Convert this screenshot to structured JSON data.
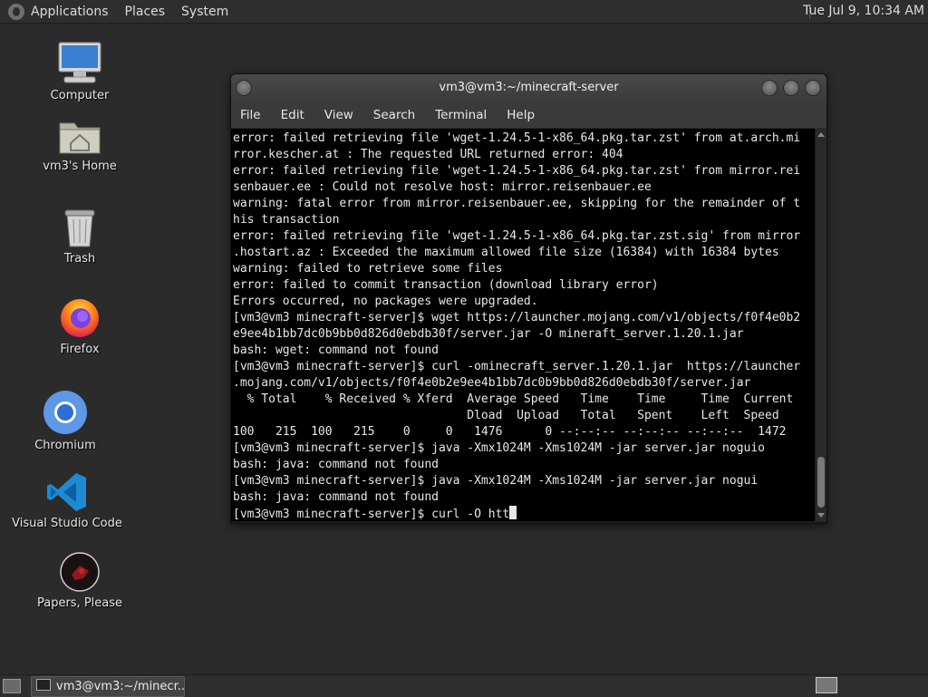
{
  "top_panel": {
    "menu": [
      "Applications",
      "Places",
      "System"
    ],
    "clock": "Tue Jul  9, 10:34 AM"
  },
  "desktop_icons": [
    {
      "label": "Computer",
      "icon": "computer-icon"
    },
    {
      "label": "vm3's Home",
      "icon": "home-folder-icon"
    },
    {
      "label": "Trash",
      "icon": "trash-icon"
    },
    {
      "label": "Firefox",
      "icon": "firefox-icon"
    },
    {
      "label": "Chromium",
      "icon": "chromium-icon"
    },
    {
      "label": "Visual Studio Code",
      "icon": "vscode-icon"
    },
    {
      "label": "Papers, Please",
      "icon": "papers-please-icon"
    }
  ],
  "terminal": {
    "title": "vm3@vm3:~/minecraft-server",
    "menu": [
      "File",
      "Edit",
      "View",
      "Search",
      "Terminal",
      "Help"
    ],
    "lines": [
      "error: failed retrieving file 'wget-1.24.5-1-x86_64.pkg.tar.zst' from at.arch.mi",
      "rror.kescher.at : The requested URL returned error: 404",
      "error: failed retrieving file 'wget-1.24.5-1-x86_64.pkg.tar.zst' from mirror.rei",
      "senbauer.ee : Could not resolve host: mirror.reisenbauer.ee",
      "warning: fatal error from mirror.reisenbauer.ee, skipping for the remainder of t",
      "his transaction",
      "error: failed retrieving file 'wget-1.24.5-1-x86_64.pkg.tar.zst.sig' from mirror",
      ".hostart.az : Exceeded the maximum allowed file size (16384) with 16384 bytes",
      "warning: failed to retrieve some files",
      "error: failed to commit transaction (download library error)",
      "Errors occurred, no packages were upgraded.",
      "[vm3@vm3 minecraft-server]$ wget https://launcher.mojang.com/v1/objects/f0f4e0b2",
      "e9ee4b1bb7dc0b9bb0d826d0ebdb30f/server.jar -O mineraft_server.1.20.1.jar",
      "bash: wget: command not found",
      "[vm3@vm3 minecraft-server]$ curl -ominecraft_server.1.20.1.jar  https://launcher",
      ".mojang.com/v1/objects/f0f4e0b2e9ee4b1bb7dc0b9bb0d826d0ebdb30f/server.jar",
      "  % Total    % Received % Xferd  Average Speed   Time    Time     Time  Current",
      "                                 Dload  Upload   Total   Spent    Left  Speed",
      "100   215  100   215    0     0   1476      0 --:--:-- --:--:-- --:--:--  1472",
      "[vm3@vm3 minecraft-server]$ java -Xmx1024M -Xms1024M -jar server.jar noguio",
      "bash: java: command not found",
      "[vm3@vm3 minecraft-server]$ java -Xmx1024M -Xms1024M -jar server.jar nogui",
      "bash: java: command not found"
    ],
    "prompt": "[vm3@vm3 minecraft-server]$ curl -O htt"
  },
  "taskbar": {
    "task_label": "vm3@vm3:~/minecr..."
  }
}
